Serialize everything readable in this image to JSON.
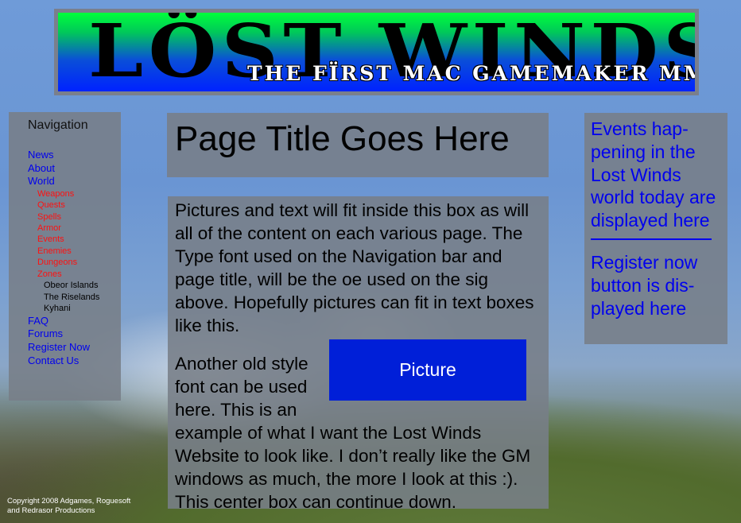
{
  "banner": {
    "title": "LÖST WINDS",
    "subtitle": "THE FÏRST MAC GAMEMAKER MMORPG"
  },
  "nav": {
    "heading": "Navigation",
    "news": "News",
    "about": "About",
    "world": "World",
    "world_items": [
      "Weapons",
      "Quests",
      "Spells",
      "Armor",
      "Events",
      "Enemies",
      "Dungeons",
      "Zones"
    ],
    "zones": [
      "Obeor Islands",
      "The Riselands",
      "Kyhani"
    ],
    "faq": "FAQ",
    "forums": "Forums",
    "register": "Register Now",
    "contact": "Contact Us"
  },
  "main": {
    "title": "Page Title Goes Here",
    "paragraph1": "Pictures and text will fit inside this box as will all of the content on each various page. The Type font used on the Navigation bar and page title, will be the oe used on the sig above. Hopefully pictures can fit in text boxes like this.",
    "picture_label": "Picture",
    "paragraph2": "Another old style font can be used here. This is an example of what I want the Lost Winds Website to look like. I don’t really like the GM windows as much, the more I look at this :). This center box can continue down."
  },
  "sidebar": {
    "events_text": "Events hap-pening in the Lost Winds world today are displayed here",
    "register_text": "Register now button is dis-played here"
  },
  "footer": {
    "copyright_line1": "Copyright 2008 Adgames, Roguesoft",
    "copyright_line2": "and Redrasor Productions"
  },
  "colors": {
    "link": "#0000ee",
    "submenu": "#ff1010",
    "picture_fill": "#001fd8"
  }
}
